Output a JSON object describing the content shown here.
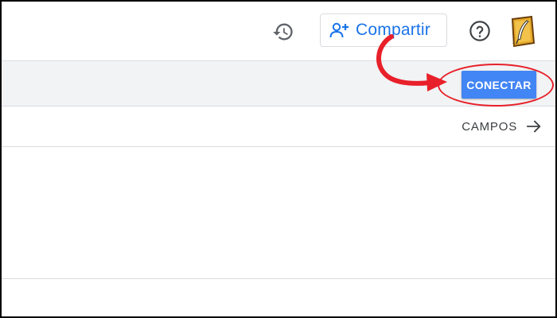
{
  "header": {
    "history_icon": "history-icon",
    "share_icon": "person-add-icon",
    "share_label": "Compartir",
    "help_icon": "help-circle-icon",
    "avatar_icon": "quill-avatar-icon"
  },
  "toolbar": {
    "connect_label": "CONECTAR"
  },
  "fields": {
    "label": "CAMPOS",
    "arrow_icon": "arrow-right-icon"
  },
  "annotation": {
    "color": "#e8202a"
  },
  "colors": {
    "accent_blue": "#1a73e8",
    "button_blue": "#4285f4",
    "toolbar_gray": "#f1f3f4",
    "divider": "#dadce0",
    "icon_gray": "#5f6368"
  }
}
